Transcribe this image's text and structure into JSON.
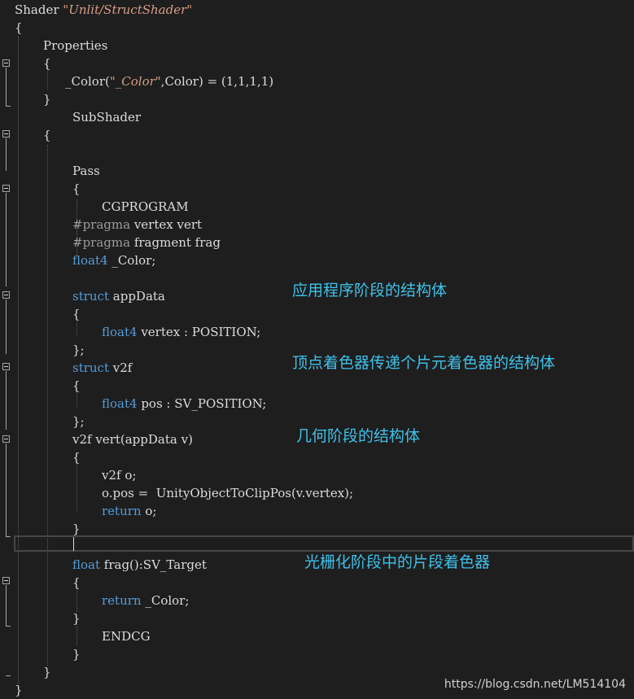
{
  "editor": {
    "lines": [
      [
        {
          "t": "Shader ",
          "c": "pl"
        },
        {
          "t": "\"Unlit/StructShader\"",
          "c": "str"
        }
      ],
      [
        {
          "t": "{",
          "c": "pl"
        }
      ],
      [
        {
          "t": "Properties",
          "c": "pl"
        }
      ],
      [
        {
          "t": "{",
          "c": "pl"
        }
      ],
      [
        {
          "t": "_Color(",
          "c": "pl"
        },
        {
          "t": "\"_Color\"",
          "c": "str"
        },
        {
          "t": ",Color) = (1,1,1,1)",
          "c": "pl"
        }
      ],
      [
        {
          "t": "}",
          "c": "pl"
        }
      ],
      [
        {
          "t": "SubShader",
          "c": "pl"
        }
      ],
      [
        {
          "t": "{",
          "c": "pl"
        }
      ],
      [],
      [
        {
          "t": "Pass",
          "c": "pl"
        }
      ],
      [
        {
          "t": "{",
          "c": "pl"
        }
      ],
      [
        {
          "t": "CGPROGRAM",
          "c": "pl"
        }
      ],
      [
        {
          "t": "#pragma",
          "c": "pp"
        },
        {
          "t": " vertex vert",
          "c": "pl"
        }
      ],
      [
        {
          "t": "#pragma",
          "c": "pp"
        },
        {
          "t": " fragment frag",
          "c": "pl"
        }
      ],
      [
        {
          "t": "float4",
          "c": "kw"
        },
        {
          "t": " _Color;",
          "c": "pl"
        }
      ],
      [],
      [
        {
          "t": "struct",
          "c": "kw"
        },
        {
          "t": " appData",
          "c": "pl"
        }
      ],
      [
        {
          "t": "{",
          "c": "pl"
        }
      ],
      [
        {
          "t": "float4",
          "c": "kw"
        },
        {
          "t": " vertex : POSITION;",
          "c": "pl"
        }
      ],
      [
        {
          "t": "};",
          "c": "pl"
        }
      ],
      [
        {
          "t": "struct",
          "c": "kw"
        },
        {
          "t": " v2f",
          "c": "pl"
        }
      ],
      [
        {
          "t": "{",
          "c": "pl"
        }
      ],
      [
        {
          "t": "float4",
          "c": "kw"
        },
        {
          "t": " pos : SV_POSITION;",
          "c": "pl"
        }
      ],
      [
        {
          "t": "};",
          "c": "pl"
        }
      ],
      [
        {
          "t": "v2f vert(appData v)",
          "c": "pl"
        }
      ],
      [
        {
          "t": "{",
          "c": "pl"
        }
      ],
      [
        {
          "t": "v2f o;",
          "c": "pl"
        }
      ],
      [
        {
          "t": "o.pos =  UnityObjectToClipPos(v.vertex);",
          "c": "pl"
        }
      ],
      [
        {
          "t": "return",
          "c": "kw"
        },
        {
          "t": " o;",
          "c": "pl"
        }
      ],
      [
        {
          "t": "}",
          "c": "pl"
        }
      ],
      [],
      [
        {
          "t": "float",
          "c": "kw"
        },
        {
          "t": " frag():SV_Target",
          "c": "pl"
        }
      ],
      [
        {
          "t": "{",
          "c": "pl"
        }
      ],
      [
        {
          "t": "return",
          "c": "kw"
        },
        {
          "t": " _Color;",
          "c": "pl"
        }
      ],
      [
        {
          "t": "}",
          "c": "pl"
        }
      ],
      [
        {
          "t": "ENDCG",
          "c": "pl"
        }
      ],
      [
        {
          "t": "}",
          "c": "pl"
        }
      ],
      [
        {
          "t": "}",
          "c": "pl"
        }
      ],
      [
        {
          "t": "}",
          "c": "pl"
        }
      ]
    ]
  },
  "annotations": {
    "app_stage": "应用程序阶段的结构体",
    "vertex_to_fragment": "顶点着色器传递个片元着色器的结构体",
    "geometry_stage": "几何阶段的结构体",
    "raster_stage": "光栅化阶段中的片段着色器"
  },
  "watermark": "https://blog.csdn.net/LM514104",
  "colors": {
    "background": "#1e1e1e",
    "text": "#dcdcdc",
    "keyword": "#569cd6",
    "string": "#d69d85",
    "preprocessor": "#9b9b9b",
    "annotation": "#3fc0e8"
  }
}
